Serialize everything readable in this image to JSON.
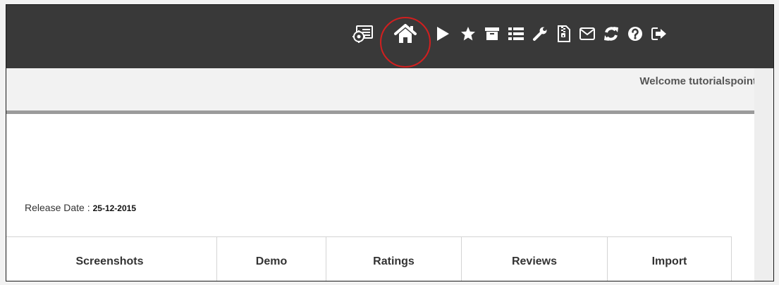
{
  "toolbar": {
    "icons": [
      {
        "name": "dashboard-icon",
        "label": "Dashboard"
      },
      {
        "name": "home-icon",
        "label": "Home",
        "highlighted": true
      },
      {
        "name": "play-icon",
        "label": "Play"
      },
      {
        "name": "star-icon",
        "label": "Favorites"
      },
      {
        "name": "archive-icon",
        "label": "Archive"
      },
      {
        "name": "list-icon",
        "label": "List"
      },
      {
        "name": "wrench-icon",
        "label": "Tools"
      },
      {
        "name": "file-zip-icon",
        "label": "Zip File"
      },
      {
        "name": "envelope-icon",
        "label": "Mail"
      },
      {
        "name": "refresh-icon",
        "label": "Refresh"
      },
      {
        "name": "help-icon",
        "label": "Help"
      },
      {
        "name": "sign-out-icon",
        "label": "Sign Out"
      }
    ],
    "highlight_color": "#d21f1f",
    "background_color": "#393939"
  },
  "header": {
    "welcome_text": "Welcome tutorialspoint"
  },
  "extension": {
    "release_label": "Release Date :",
    "release_date": "25-12-2015"
  },
  "tabs": [
    {
      "label": "Screenshots"
    },
    {
      "label": "Demo"
    },
    {
      "label": "Ratings"
    },
    {
      "label": "Reviews"
    },
    {
      "label": "Import"
    }
  ]
}
